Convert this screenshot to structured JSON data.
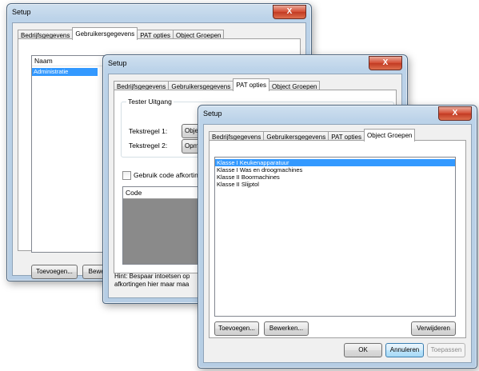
{
  "title": "Setup",
  "tabs": [
    "Bedrijfsgegevens",
    "Gebruikersgegevens",
    "PAT opties",
    "Object Groepen"
  ],
  "close_glyph": "X",
  "window1": {
    "active_tab": "Gebruikersgegevens",
    "list_header": "Naam",
    "list_items": [
      "Administratie"
    ],
    "add_button": "Toevoegen...",
    "edit_button": "Bewerk"
  },
  "window2": {
    "active_tab": "PAT opties",
    "group_title": "Tester Uitgang",
    "line1_label": "Tekstregel 1:",
    "line1_button": "Objec",
    "line2_label": "Tekstregel 2:",
    "line2_button": "Opme",
    "checkbox_label": "Gebruik code afkorting",
    "code_header": "Code",
    "hint_line1": "Hint: Bespaar intoetsen op",
    "hint_line2": "afkortingen hier maar maa"
  },
  "window3": {
    "active_tab": "Object Groepen",
    "list_items": [
      "Klasse I Keukenapparatuur",
      "Klasse I Was en droogmachines",
      "Klasse II Boormachines",
      "Klasse II Slijptol"
    ],
    "selected_index": 0,
    "add_button": "Toevoegen...",
    "edit_button": "Bewerken...",
    "delete_button": "Verwijderen",
    "ok_button": "OK",
    "cancel_button": "Annuleren",
    "apply_button": "Toepassen"
  }
}
